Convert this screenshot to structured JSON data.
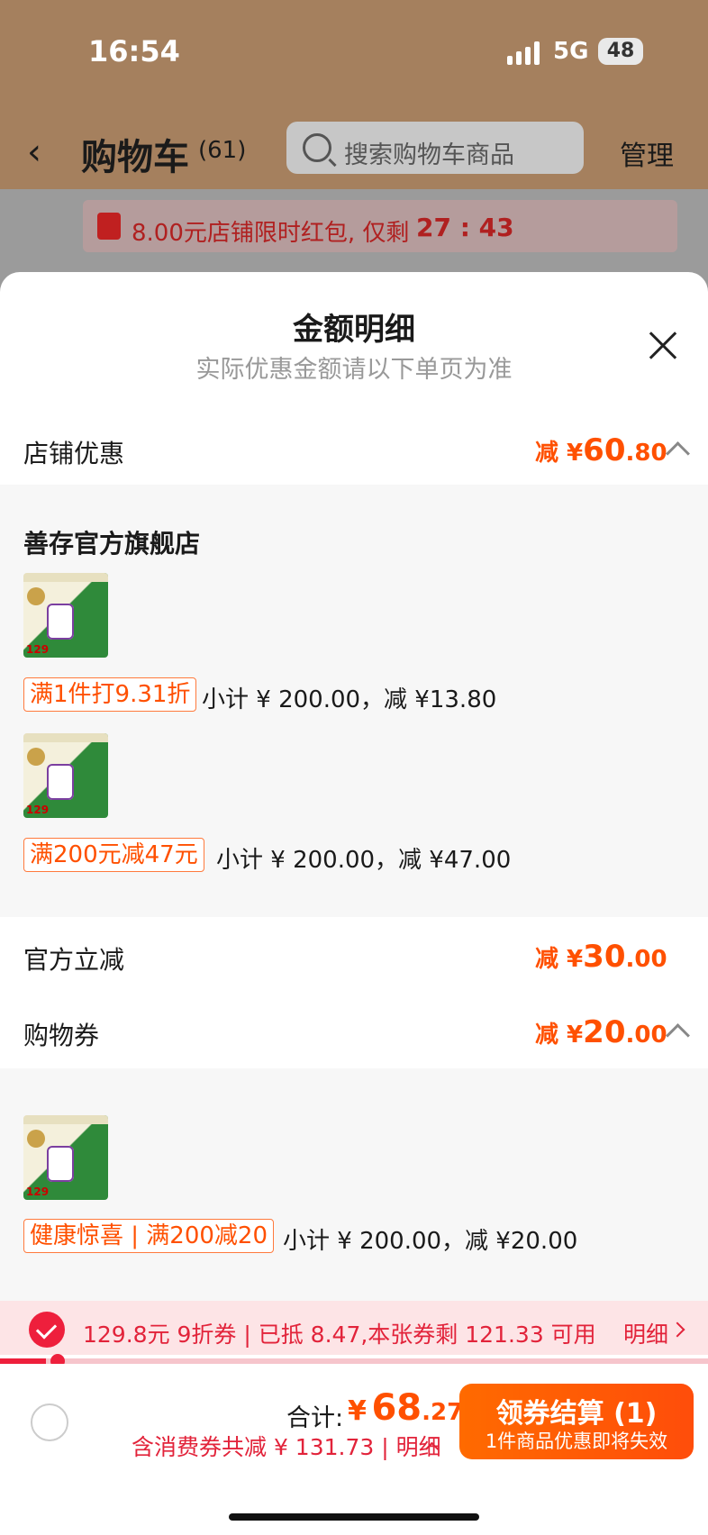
{
  "status_bar": {
    "time": "16:54",
    "network": "5G",
    "battery": "48"
  },
  "header": {
    "title": "购物车",
    "count": "(61)",
    "search_placeholder": "搜索购物车商品",
    "manage": "管理"
  },
  "banner": {
    "text": "8.00元店铺限时红包, 仅剩",
    "timer": "27 : 43"
  },
  "sheet": {
    "title": "金额明细",
    "subtitle": "实际优惠金额请以下单页为准",
    "store_discount": {
      "label": "店铺优惠",
      "prefix": "减 ¥",
      "int": "60",
      "dec": ".80"
    },
    "store": {
      "name": "善存官方旗舰店",
      "items": [
        {
          "thumb_price": "129",
          "tag": "满1件打9.31折",
          "subtotal": "小计 ¥ 200.00，减 ¥13.80"
        },
        {
          "thumb_price": "129",
          "tag": "满200元减47元",
          "subtotal": "小计 ¥ 200.00，减 ¥47.00"
        }
      ]
    },
    "official_discount": {
      "label": "官方立减",
      "prefix": "减 ¥",
      "int": "30",
      "dec": ".00"
    },
    "coupon": {
      "label": "购物券",
      "prefix": "减 ¥",
      "int": "20",
      "dec": ".00"
    },
    "coupon_item": {
      "thumb_price": "129",
      "tag": "健康惊喜 | 满200减20",
      "subtotal": "小计 ¥ 200.00，减 ¥20.00"
    }
  },
  "coupon_bar": {
    "text": "129.8元 9折券 | 已抵 8.47,本张券剩 121.33 可用",
    "detail": "明细",
    "used_fraction": 0.065
  },
  "footer": {
    "total_label": "合计:",
    "currency": "¥",
    "total_int": "68",
    "total_dec": ".27",
    "savings": "含消费券共减 ¥ 131.73 | 明细",
    "checkout_main": "领券结算 (1)",
    "checkout_sub": "1件商品优惠即将失效"
  },
  "colors": {
    "accent": "#ff5000",
    "red": "#e2233a"
  }
}
